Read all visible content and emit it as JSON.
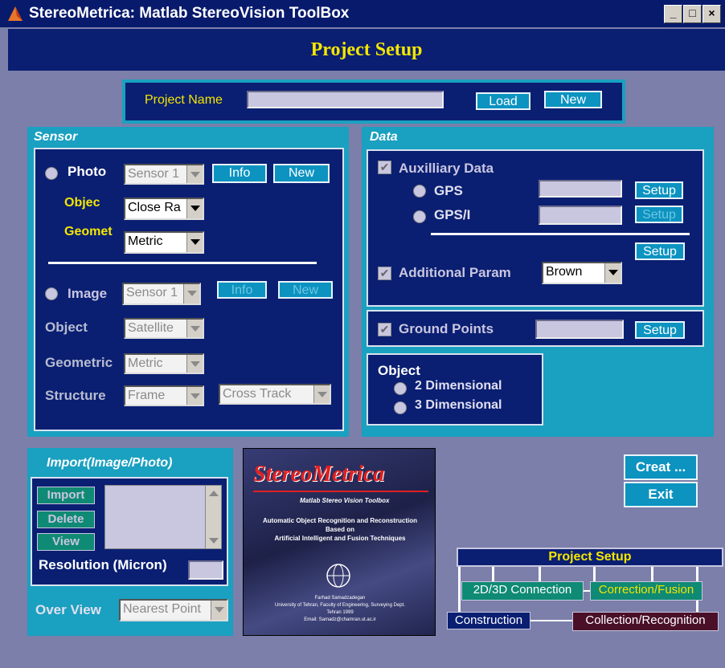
{
  "window": {
    "title": "StereoMetrica: Matlab StereoVision ToolBox",
    "min": "_",
    "max": "□",
    "close": "×"
  },
  "header": {
    "title": "Project Setup"
  },
  "project": {
    "label": "Project Name",
    "value": "",
    "load_label": "Load",
    "new_label": "New"
  },
  "sensor": {
    "title": "Sensor",
    "photo": {
      "label": "Photo",
      "sensor_value": "Sensor 1",
      "info_label": "Info",
      "new_label": "New",
      "object_label": "Objec",
      "object_value": "Close Ra",
      "geometric_label": "Geomet",
      "geometric_value": "Metric"
    },
    "image": {
      "label": "Image",
      "sensor_value": "Sensor 1",
      "info_label": "Info",
      "new_label": "New",
      "object_label": "Object",
      "object_value": "Satellite",
      "geometric_label": "Geometric",
      "geometric_value": "Metric",
      "structure_label": "Structure",
      "structure_value": "Frame",
      "track_value": "Cross Track"
    }
  },
  "data": {
    "title": "Data",
    "aux_label": "Auxilliary Data",
    "gps_label": "GPS",
    "gps_setup": "Setup",
    "gpsi_label": "GPS/I",
    "gpsi_setup": "Setup",
    "aux_setup": "Setup",
    "add_param_label": "Additional Param",
    "add_param_value": "Brown",
    "ground_label": "Ground Points",
    "ground_setup": "Setup"
  },
  "object": {
    "title": "Object",
    "opt1": "2 Dimensional",
    "opt2": "3 Dimensional"
  },
  "import": {
    "title": "Import(Image/Photo)",
    "import_label": "Import",
    "delete_label": "Delete",
    "view_label": "View",
    "resolution_label": "Resolution (Micron)",
    "overview_label": "Over View",
    "overview_value": "Nearest Point"
  },
  "logo": {
    "title": "StereoMetrica",
    "subtitle": "Matlab Stereo Vision Toolbox",
    "line1": "Automatic Object Recognition and Reconstruction",
    "line2": "Based on",
    "line3": "Artificial Intelligent and Fusion Techniques",
    "foot1": "Farhad Samadzadegan",
    "foot2": "University of Tehran, Faculty of Engineering, Surveying Dept.",
    "foot3": "Tehran 1999",
    "foot4": "Email: Samadz@chamran.ut.ac.ir"
  },
  "actions": {
    "create_label": "Creat ...",
    "exit_label": "Exit"
  },
  "diagram": {
    "title": "Project Setup",
    "conn": "2D/3D Connection",
    "corr": "Correction/Fusion",
    "constr": "Construction",
    "collect": "Collection/Recognition"
  },
  "colors": {
    "title_bar": "#081a6c",
    "panel": "#0a1f72",
    "frame": "#1aa0c0",
    "background": "#7b7fa9",
    "accent_yellow": "#f5e600"
  }
}
